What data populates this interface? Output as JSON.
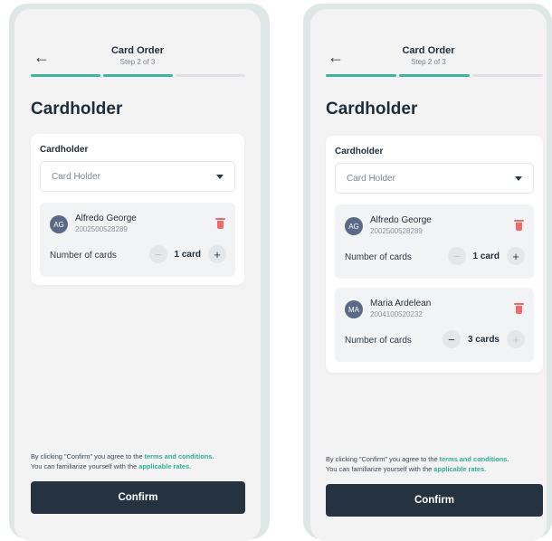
{
  "screens": [
    {
      "header": {
        "title": "Card Order",
        "step": "Step 2 of 3",
        "back_icon": "arrow-left-icon"
      },
      "title": "Cardholder",
      "section_label": "Cardholder",
      "select_placeholder": "Card Holder",
      "holders": [
        {
          "initials": "AG",
          "name": "Alfredo George",
          "number": "2002500528289",
          "count_label": "Number of cards",
          "count": "1 card"
        }
      ],
      "terms": {
        "prefix": "By clicking \"Confirm\" you agree to the ",
        "terms_link": "terms and conditions.",
        "line2_prefix": "You can familiarize yourself with the ",
        "rates_link": "applicable rates."
      },
      "confirm_label": "Confirm"
    },
    {
      "header": {
        "title": "Card Order",
        "step": "Step 2 of 3",
        "back_icon": "arrow-left-icon"
      },
      "title": "Cardholder",
      "section_label": "Cardholder",
      "select_placeholder": "Card Holder",
      "holders": [
        {
          "initials": "AG",
          "name": "Alfredo George",
          "number": "2002500528289",
          "count_label": "Number of cards",
          "count": "1 card"
        },
        {
          "initials": "MA",
          "name": "Maria Ardelean",
          "number": "2004100520232",
          "count_label": "Number of cards",
          "count": "3 cards"
        }
      ],
      "terms": {
        "prefix": "By clicking \"Confirm\" you agree to the ",
        "terms_link": "terms and conditions.",
        "line2_prefix": "You can familiarize yourself with the ",
        "rates_link": "applicable rates."
      },
      "confirm_label": "Confirm"
    }
  ],
  "colors": {
    "accent": "#3fb3a1",
    "link": "#2fae98",
    "button": "#253341",
    "trash": "#f06a6a",
    "avatar": "#5a6a86",
    "frame": "#dfe7e6"
  }
}
